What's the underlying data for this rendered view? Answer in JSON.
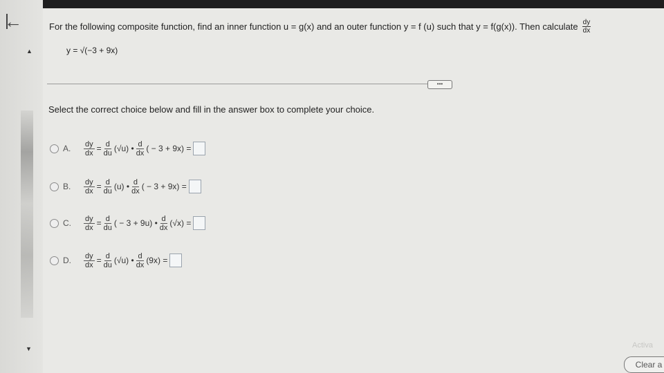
{
  "question": {
    "text": "For the following composite function, find an inner function u = g(x) and an outer function y = f (u) such that y = f(g(x)). Then calculate",
    "deriv_num": "dy",
    "deriv_den": "dx"
  },
  "given_function": "y = √(−3 + 9x)",
  "more_button_label": "•••",
  "instruction": "Select the correct choice below and fill in the answer box to complete your choice.",
  "options": [
    {
      "letter": "A.",
      "lhs_num": "dy",
      "lhs_den": "dx",
      "d1_num": "d",
      "d1_den": "du",
      "arg1": "(√u) •",
      "d2_num": "d",
      "d2_den": "dx",
      "arg2": "( − 3 + 9x) ="
    },
    {
      "letter": "B.",
      "lhs_num": "dy",
      "lhs_den": "dx",
      "d1_num": "d",
      "d1_den": "du",
      "arg1": "(u) •",
      "d2_num": "d",
      "d2_den": "dx",
      "arg2": "( − 3 + 9x) ="
    },
    {
      "letter": "C.",
      "lhs_num": "dy",
      "lhs_den": "dx",
      "d1_num": "d",
      "d1_den": "du",
      "arg1": "( − 3 + 9u) •",
      "d2_num": "d",
      "d2_den": "dx",
      "arg2": "(√x) ="
    },
    {
      "letter": "D.",
      "lhs_num": "dy",
      "lhs_den": "dx",
      "d1_num": "d",
      "d1_den": "du",
      "arg1": "(√u) •",
      "d2_num": "d",
      "d2_den": "dx",
      "arg2": "(9x) ="
    }
  ],
  "activate_text": "Activa",
  "clear_button_label": "Clear a"
}
